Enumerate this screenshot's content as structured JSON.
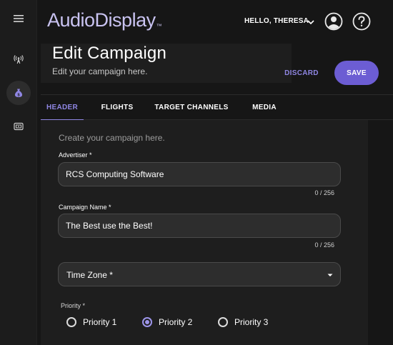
{
  "app": {
    "logo": "AudioDisplay",
    "logo_tm": "™"
  },
  "topbar": {
    "greeting": "HELLO, THERESA",
    "account_icon": "account-circle-icon",
    "help_icon": "help-circle-icon"
  },
  "sidebar": {
    "items": [
      {
        "icon": "menu-icon"
      },
      {
        "icon": "broadcast-antenna-icon"
      },
      {
        "icon": "money-bag-icon",
        "active": true
      },
      {
        "icon": "media-card-icon"
      }
    ]
  },
  "header": {
    "title": "Edit Campaign",
    "subtitle": "Edit your campaign here.",
    "discard_label": "DISCARD",
    "save_label": "SAVE"
  },
  "tabs": [
    {
      "label": "HEADER",
      "active": true
    },
    {
      "label": "FLIGHTS",
      "active": false
    },
    {
      "label": "TARGET CHANNELS",
      "active": false
    },
    {
      "label": "MEDIA",
      "active": false
    }
  ],
  "form": {
    "hint": "Create your campaign here.",
    "advertiser": {
      "label": "Advertiser *",
      "value": "RCS Computing Software",
      "counter": "0 / 256"
    },
    "campaign_name": {
      "label": "Campaign Name *",
      "value": "The Best use the Best!",
      "counter": "0 / 256"
    },
    "time_zone": {
      "label": "Time Zone *"
    },
    "priority": {
      "label": "Priority *",
      "options": [
        {
          "label": "Priority 1",
          "checked": false
        },
        {
          "label": "Priority 2",
          "checked": true
        },
        {
          "label": "Priority 3",
          "checked": false
        }
      ]
    }
  },
  "colors": {
    "accent": "#6c5dd3",
    "accent_text": "#8f86e3",
    "logo": "#c9c3f1",
    "background": "#161616",
    "panel": "#1e1e1e",
    "field": "#2d2d2d"
  }
}
